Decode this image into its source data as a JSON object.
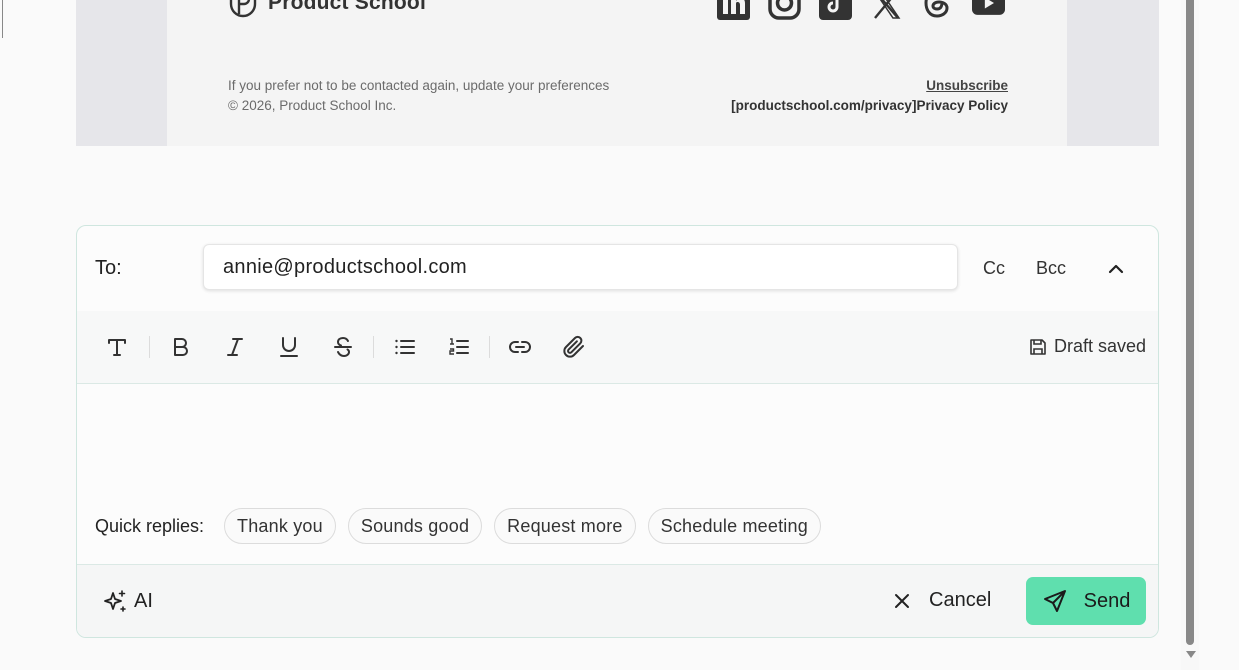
{
  "email_footer": {
    "brand_name": "Product School",
    "social_icons": [
      "linkedin-icon",
      "instagram-icon",
      "tiktok-icon",
      "x-icon",
      "threads-icon",
      "youtube-icon"
    ],
    "preferences_text": "If you prefer not to be contacted again, update your preferences",
    "copyright": "© 2026, Product School Inc.",
    "unsubscribe": "Unsubscribe",
    "privacy": "[productschool.com/privacy]Privacy Policy"
  },
  "composer": {
    "to_label": "To:",
    "to_value": "annie@productschool.com",
    "cc_label": "Cc",
    "bcc_label": "Bcc",
    "toolbar_icons": [
      "text-style-icon",
      "bold-icon",
      "italic-icon",
      "underline-icon",
      "strikethrough-icon",
      "bullet-list-icon",
      "numbered-list-icon",
      "link-icon",
      "attachment-icon"
    ],
    "draft_status": "Draft saved",
    "quick_replies_label": "Quick replies:",
    "quick_replies": [
      "Thank you",
      "Sounds good",
      "Request more",
      "Schedule meeting"
    ],
    "ai_label": "AI",
    "cancel_label": "Cancel",
    "send_label": "Send",
    "colors": {
      "send_bg": "#5fdfae",
      "border": "#cfe6df"
    }
  }
}
